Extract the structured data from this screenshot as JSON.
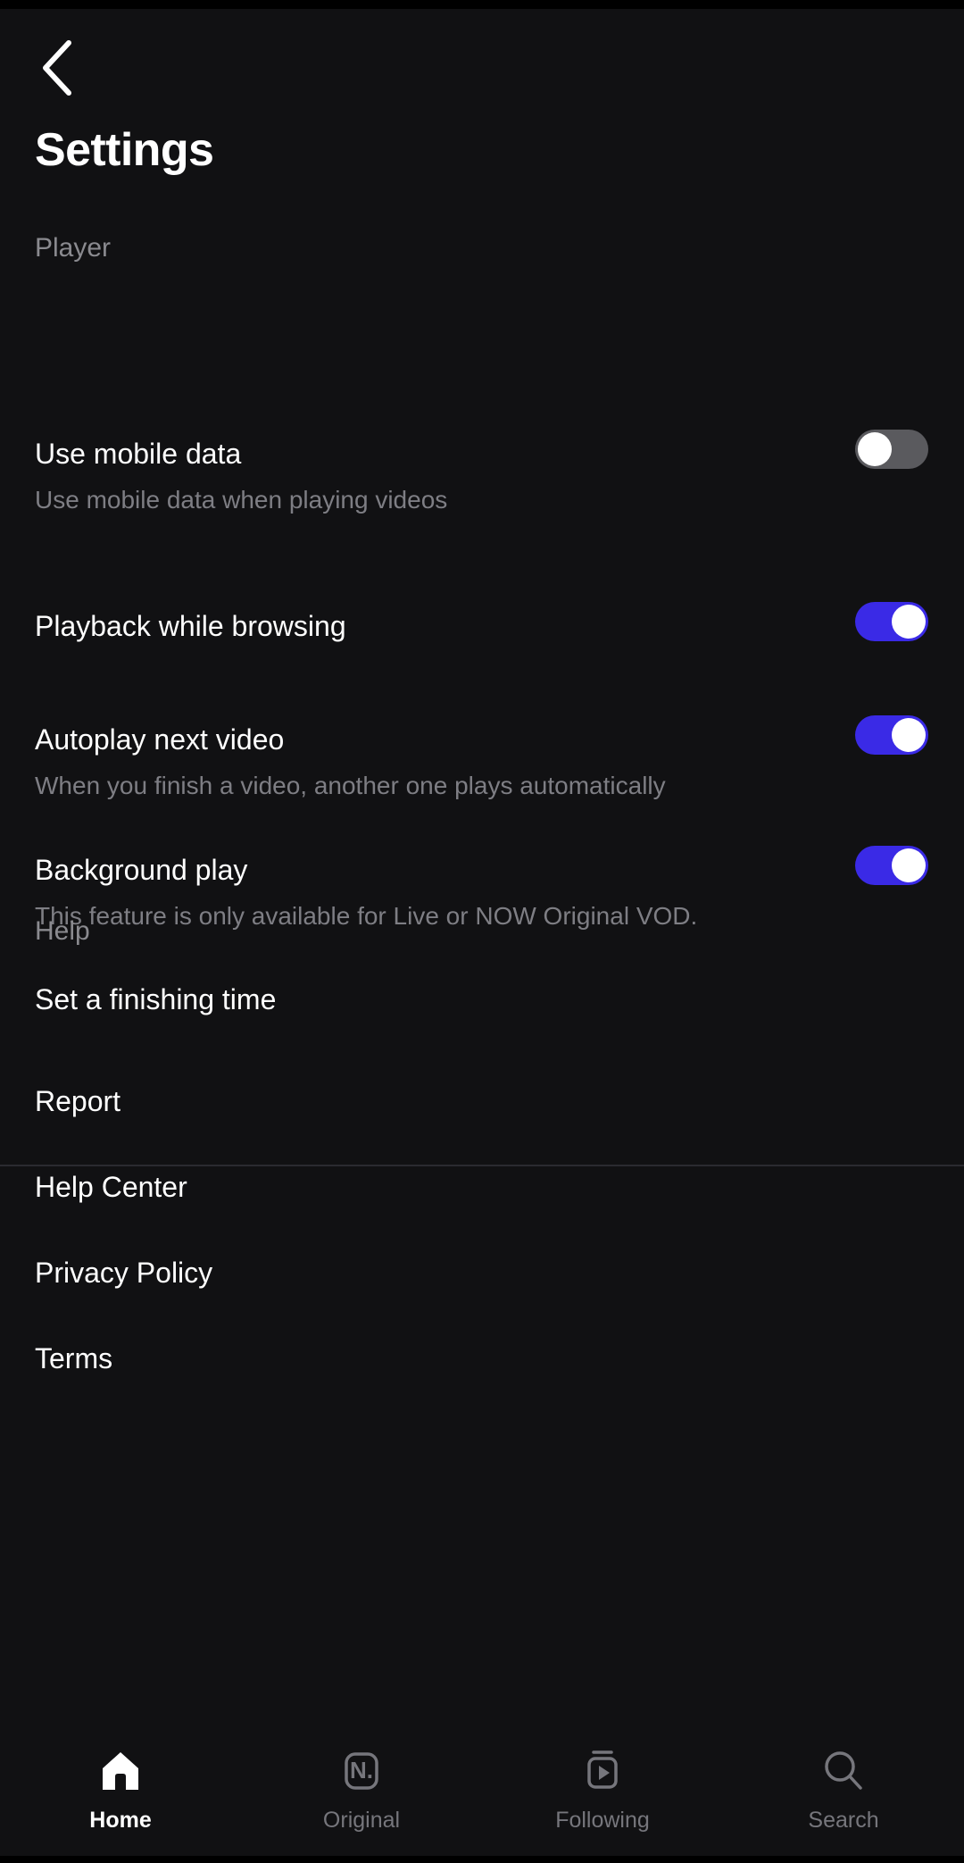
{
  "header": {
    "back_icon": "chevron-left-icon",
    "title": "Settings"
  },
  "sections": {
    "player": {
      "label": "Player",
      "rows": [
        {
          "title": "Use mobile data",
          "subtitle": "Use mobile data when playing videos",
          "control": "toggle",
          "value": "off"
        },
        {
          "title": "Playback while browsing",
          "subtitle": "",
          "control": "toggle",
          "value": "on"
        },
        {
          "title": "Autoplay next video",
          "subtitle": "When you finish a video, another one plays automatically",
          "control": "toggle",
          "value": "on"
        },
        {
          "title": "Background play",
          "subtitle": "This feature is only available for Live or NOW Original VOD.",
          "control": "toggle",
          "value": "on"
        },
        {
          "title": "Set a finishing time",
          "subtitle": "",
          "control": "none",
          "value": ""
        }
      ]
    },
    "help": {
      "label": "Help",
      "rows": [
        {
          "title": "Report"
        },
        {
          "title": "Help Center"
        },
        {
          "title": "Privacy Policy"
        },
        {
          "title": "Terms"
        }
      ]
    }
  },
  "bottom_nav": {
    "items": [
      {
        "label": "Home",
        "icon": "home-icon",
        "active": true
      },
      {
        "label": "Original",
        "icon": "original-n-icon",
        "active": false
      },
      {
        "label": "Following",
        "icon": "following-play-icon",
        "active": false
      },
      {
        "label": "Search",
        "icon": "search-icon",
        "active": false
      }
    ]
  },
  "colors": {
    "background": "#111113",
    "toggle_on": "#3a2ae6",
    "toggle_off": "#5a5a5e",
    "text_primary": "#ffffff",
    "text_secondary": "#7e7e84",
    "divider": "#2b2b30"
  },
  "icon_glyphs": {
    "original_letter": "N."
  }
}
